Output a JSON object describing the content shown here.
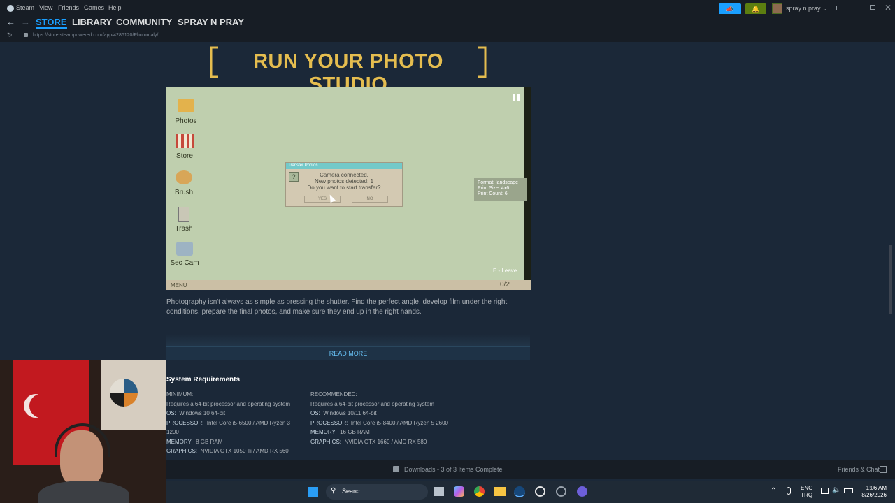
{
  "menu": {
    "items": [
      "Steam",
      "View",
      "Friends",
      "Games",
      "Help"
    ],
    "user_name": "spray n pray"
  },
  "nav": {
    "tabs": [
      "STORE",
      "LIBRARY",
      "COMMUNITY",
      "SPRAY N PRAY"
    ],
    "url": "https://store.steampowered.com/app/4286120/Photomaly/"
  },
  "hero": {
    "title": "RUN YOUR PHOTO STUDIO"
  },
  "video": {
    "desktop_icons": [
      "Photos",
      "Store",
      "Brush",
      "Trash",
      "Sec Cam"
    ],
    "dialog": {
      "title": "Transfer Photos",
      "line1": "Camera connected.",
      "line2": "New photos detected: 1",
      "line3": "Do you want to start transfer?",
      "yes": "YES",
      "no": "NO"
    },
    "info": {
      "format": "Format: landscape",
      "print_size": "Print Size: 4x6",
      "print_count": "Print Count: 6"
    },
    "leave_hint": "E - Leave",
    "menu_label": "MENU",
    "counter": "0/2"
  },
  "description": "Photography isn't always as simple as pressing the shutter. Find the perfect angle, develop film under the right conditions, prepare the final photos, and make sure they end up in the right hands.",
  "read_more": "READ MORE",
  "sysreq": {
    "title": "System Requirements",
    "minimum": {
      "heading": "MINIMUM:",
      "note": "Requires a 64-bit processor and operating system",
      "os_label": "OS:",
      "os": "Windows 10 64-bit",
      "proc_label": "PROCESSOR:",
      "proc": "Intel Core i5-6500 / AMD Ryzen 3 1200",
      "mem_label": "MEMORY:",
      "mem": "8 GB RAM",
      "gfx_label": "GRAPHICS:",
      "gfx": "NVIDIA GTX 1050 Ti / AMD RX 560"
    },
    "recommended": {
      "heading": "RECOMMENDED:",
      "note": "Requires a 64-bit processor and operating system",
      "os_label": "OS:",
      "os": "Windows 10/11 64-bit",
      "proc_label": "PROCESSOR:",
      "proc": "Intel Core i5-8400 / AMD Ryzen 5 2600",
      "mem_label": "MEMORY:",
      "mem": "16 GB RAM",
      "gfx_label": "GRAPHICS:",
      "gfx": "NVIDIA GTX 1660 / AMD RX 580"
    }
  },
  "downloads": {
    "status": "Downloads - 3 of 3 Items Complete",
    "friends": "Friends & Chat"
  },
  "taskbar": {
    "search": "Search",
    "lang1": "ENG",
    "lang2": "TRQ",
    "time": "1:06 AM",
    "date": "8/26/2026"
  },
  "colors": {
    "accent": "#1a9fff",
    "green": "#5c7e10",
    "title_gold": "#e5bd4f",
    "link": "#67c1f5"
  }
}
